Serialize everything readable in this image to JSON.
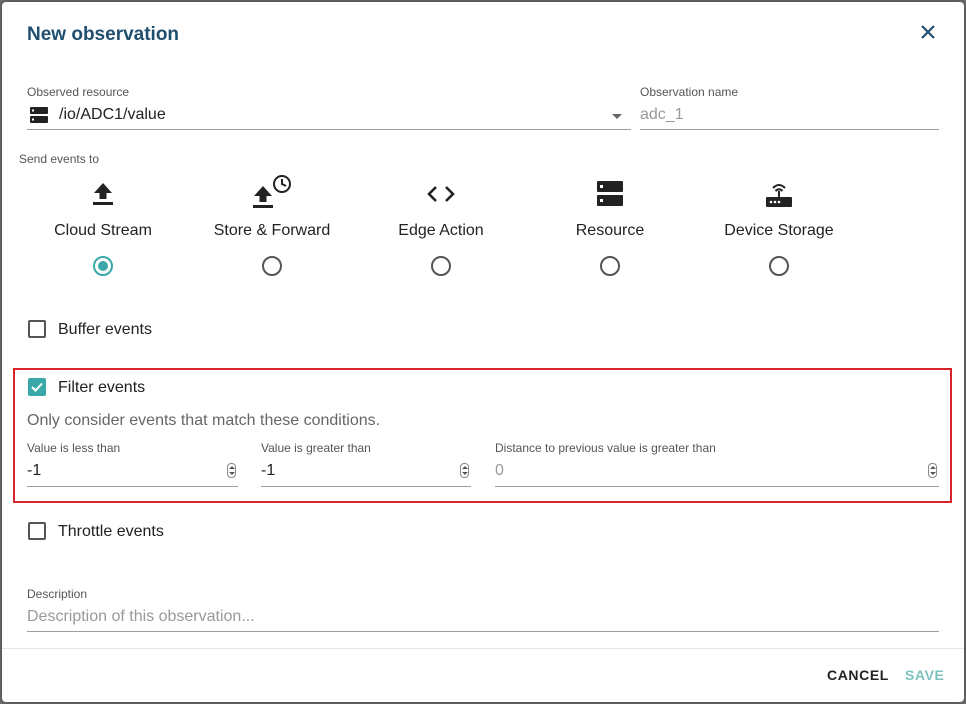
{
  "dialog": {
    "title": "New observation",
    "close_icon": "close-icon"
  },
  "resource": {
    "label": "Observed resource",
    "value": "/io/ADC1/value",
    "icon": "server-icon"
  },
  "observation_name": {
    "label": "Observation name",
    "placeholder": "adc_1"
  },
  "send_events": {
    "label": "Send events to",
    "options": [
      {
        "label": "Cloud Stream",
        "icon": "upload-icon",
        "selected": true
      },
      {
        "label": "Store & Forward",
        "icon": "upload-clock-icon",
        "selected": false
      },
      {
        "label": "Edge Action",
        "icon": "code-icon",
        "selected": false
      },
      {
        "label": "Resource",
        "icon": "server-icon",
        "selected": false
      },
      {
        "label": "Device Storage",
        "icon": "router-icon",
        "selected": false
      }
    ]
  },
  "buffer": {
    "label": "Buffer events",
    "checked": false
  },
  "filter": {
    "label": "Filter events",
    "checked": true,
    "description": "Only consider events that match these conditions.",
    "less_than": {
      "label": "Value is less than",
      "value": "-1"
    },
    "greater_than": {
      "label": "Value is greater than",
      "value": "-1"
    },
    "distance": {
      "label": "Distance to previous value is greater than",
      "placeholder": "0"
    }
  },
  "throttle": {
    "label": "Throttle events",
    "checked": false
  },
  "description": {
    "label": "Description",
    "placeholder": "Description of this observation..."
  },
  "footer": {
    "cancel_label": "CANCEL",
    "save_label": "SAVE"
  },
  "colors": {
    "accent": "#3aa8a8",
    "title": "#1f4e6e",
    "highlight": "#d9232a"
  }
}
